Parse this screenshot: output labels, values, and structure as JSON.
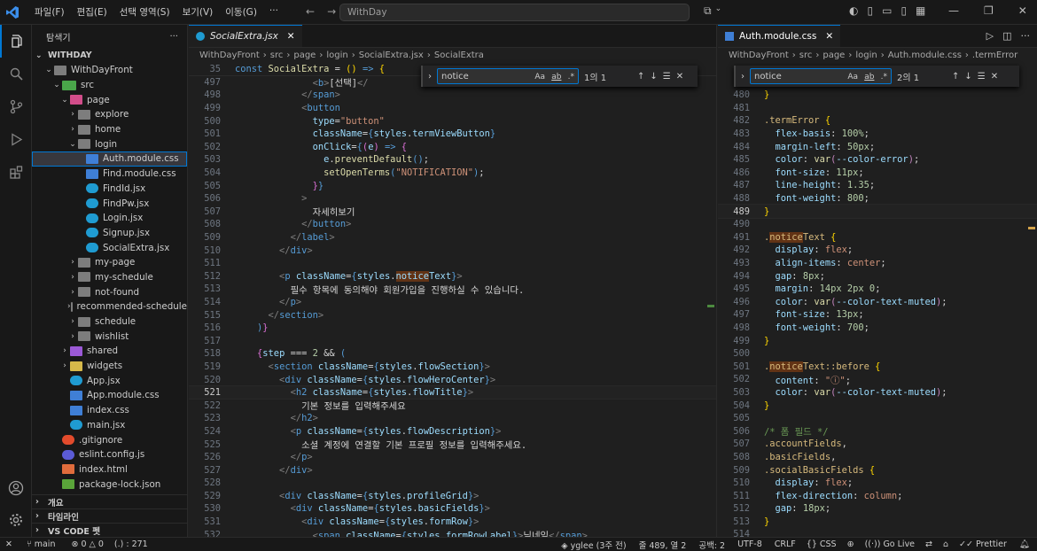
{
  "titlebar": {
    "menu": [
      "파일(F)",
      "편집(E)",
      "선택 영역(S)",
      "보기(V)",
      "이동(G)"
    ],
    "search_text": "WithDay",
    "more": "···"
  },
  "sidebar": {
    "title": "탐색기",
    "more": "···",
    "workspace": "WITHDAY",
    "tree": [
      {
        "label": "WithDayFront",
        "depth": 1,
        "chev": "⌄",
        "icon": "folder"
      },
      {
        "label": "src",
        "depth": 2,
        "chev": "⌄",
        "icon": "src"
      },
      {
        "label": "page",
        "depth": 3,
        "chev": "⌄",
        "icon": "page"
      },
      {
        "label": "explore",
        "depth": 4,
        "chev": "›",
        "icon": "folder"
      },
      {
        "label": "home",
        "depth": 4,
        "chev": "›",
        "icon": "folder"
      },
      {
        "label": "login",
        "depth": 4,
        "chev": "⌄",
        "icon": "folder"
      },
      {
        "label": "Auth.module.css",
        "depth": 5,
        "chev": "",
        "icon": "css",
        "selected": true
      },
      {
        "label": "Find.module.css",
        "depth": 5,
        "chev": "",
        "icon": "css"
      },
      {
        "label": "FindId.jsx",
        "depth": 5,
        "chev": "",
        "icon": "jsx"
      },
      {
        "label": "FindPw.jsx",
        "depth": 5,
        "chev": "",
        "icon": "jsx"
      },
      {
        "label": "Login.jsx",
        "depth": 5,
        "chev": "",
        "icon": "jsx"
      },
      {
        "label": "Signup.jsx",
        "depth": 5,
        "chev": "",
        "icon": "jsx"
      },
      {
        "label": "SocialExtra.jsx",
        "depth": 5,
        "chev": "",
        "icon": "jsx"
      },
      {
        "label": "my-page",
        "depth": 4,
        "chev": "›",
        "icon": "folder"
      },
      {
        "label": "my-schedule",
        "depth": 4,
        "chev": "›",
        "icon": "folder"
      },
      {
        "label": "not-found",
        "depth": 4,
        "chev": "›",
        "icon": "folder"
      },
      {
        "label": "recommended-schedule",
        "depth": 4,
        "chev": "›",
        "icon": "folder"
      },
      {
        "label": "schedule",
        "depth": 4,
        "chev": "›",
        "icon": "folder"
      },
      {
        "label": "wishlist",
        "depth": 4,
        "chev": "›",
        "icon": "folder"
      },
      {
        "label": "shared",
        "depth": 3,
        "chev": "›",
        "icon": "shared"
      },
      {
        "label": "widgets",
        "depth": 3,
        "chev": "›",
        "icon": "widgets"
      },
      {
        "label": "App.jsx",
        "depth": 3,
        "chev": "",
        "icon": "jsx"
      },
      {
        "label": "App.module.css",
        "depth": 3,
        "chev": "",
        "icon": "css"
      },
      {
        "label": "index.css",
        "depth": 3,
        "chev": "",
        "icon": "css"
      },
      {
        "label": "main.jsx",
        "depth": 3,
        "chev": "",
        "icon": "jsx"
      },
      {
        "label": ".gitignore",
        "depth": 2,
        "chev": "",
        "icon": "git"
      },
      {
        "label": "eslint.config.js",
        "depth": 2,
        "chev": "",
        "icon": "eslint"
      },
      {
        "label": "index.html",
        "depth": 2,
        "chev": "",
        "icon": "html"
      },
      {
        "label": "package-lock.json",
        "depth": 2,
        "chev": "",
        "icon": "json"
      }
    ],
    "sections": [
      "개요",
      "타임라인",
      "VS CODE 펫"
    ]
  },
  "left_editor": {
    "tab": "SocialExtra.jsx",
    "crumbs": [
      "WithDayFront",
      "src",
      "page",
      "login",
      "SocialExtra.jsx",
      "SocialExtra"
    ],
    "find": {
      "query": "notice",
      "count": "1의 1",
      "aa": "Aa",
      "ab": "ab",
      "re": ".*"
    },
    "sticky": {
      "num": "35",
      "code": "const SocialExtra = () => {"
    },
    "lines": [
      {
        "n": "497",
        "html": "              <span class='t'>&lt;</span><span class='tg'>b</span><span class='t'>&gt;</span><span class='tx'>[선택]</span><span class='t'>&lt;/</span>"
      },
      {
        "n": "498",
        "html": "            <span class='t'>&lt;/</span><span class='tg'>span</span><span class='t'>&gt;</span>"
      },
      {
        "n": "499",
        "html": "            <span class='t'>&lt;</span><span class='tg'>button</span>"
      },
      {
        "n": "500",
        "html": "              <span class='at'>type</span>=<span class='s'>\"button\"</span>"
      },
      {
        "n": "501",
        "html": "              <span class='at'>className</span>=<span class='k'>{</span><span class='v'>styles</span>.<span class='v'>termViewButton</span><span class='k'>}</span>"
      },
      {
        "n": "502",
        "html": "              <span class='at'>onClick</span>=<span class='k'>{</span><span class='p'>(</span><span class='v'>e</span><span class='p'>)</span> <span class='k'>=&gt;</span> <span class='p'>{</span>"
      },
      {
        "n": "503",
        "html": "                <span class='v'>e</span>.<span class='f'>preventDefault</span><span class='k'>()</span>;"
      },
      {
        "n": "504",
        "html": "                <span class='f'>setOpenTerms</span><span class='k'>(</span><span class='s'>\"NOTIFICATION\"</span><span class='k'>)</span>;"
      },
      {
        "n": "505",
        "html": "              <span class='p'>}</span><span class='k'>}</span>"
      },
      {
        "n": "506",
        "html": "            <span class='t'>&gt;</span>"
      },
      {
        "n": "507",
        "html": "              <span class='tx'>자세히보기</span>"
      },
      {
        "n": "508",
        "html": "            <span class='t'>&lt;/</span><span class='tg'>button</span><span class='t'>&gt;</span>"
      },
      {
        "n": "509",
        "html": "          <span class='t'>&lt;/</span><span class='tg'>label</span><span class='t'>&gt;</span>"
      },
      {
        "n": "510",
        "html": "        <span class='t'>&lt;/</span><span class='tg'>div</span><span class='t'>&gt;</span>"
      },
      {
        "n": "511",
        "html": ""
      },
      {
        "n": "512",
        "html": "        <span class='t'>&lt;</span><span class='tg'>p</span> <span class='at'>className</span>=<span class='k'>{</span><span class='v'>styles</span>.<span class='v'><span class='hl'>notice</span>Text</span><span class='k'>}</span><span class='t'>&gt;</span>"
      },
      {
        "n": "513",
        "html": "          <span class='tx'>필수 항목에 동의해야 회원가입을 진행하실 수 있습니다.</span>"
      },
      {
        "n": "514",
        "html": "        <span class='t'>&lt;/</span><span class='tg'>p</span><span class='t'>&gt;</span>"
      },
      {
        "n": "515",
        "html": "      <span class='t'>&lt;/</span><span class='tg'>section</span><span class='t'>&gt;</span>"
      },
      {
        "n": "516",
        "html": "    <span class='k'>)</span><span class='p'>}</span>"
      },
      {
        "n": "517",
        "html": ""
      },
      {
        "n": "518",
        "html": "    <span class='p'>{</span><span class='v'>step</span> === <span class='n'>2</span> &amp;&amp; <span class='k'>(</span>"
      },
      {
        "n": "519",
        "html": "      <span class='t'>&lt;</span><span class='tg'>section</span> <span class='at'>className</span>=<span class='k'>{</span><span class='v'>styles</span>.<span class='v'>flowSection</span><span class='k'>}</span><span class='t'>&gt;</span>"
      },
      {
        "n": "520",
        "html": "        <span class='t'>&lt;</span><span class='tg'>div</span> <span class='at'>className</span>=<span class='k'>{</span><span class='v'>styles</span>.<span class='v'>flowHeroCenter</span><span class='k'>}</span><span class='t'>&gt;</span>"
      },
      {
        "n": "521",
        "html": "          <span class='t'>&lt;</span><span class='tg'>h2</span> <span class='at'>className</span>=<span class='k'>{</span><span class='v'>styles</span>.<span class='v'>flowTitle</span><span class='k'>}</span><span class='t'>&gt;</span>",
        "cur": true
      },
      {
        "n": "522",
        "html": "            <span class='tx'>기본 정보를 입력해주세요</span>"
      },
      {
        "n": "523",
        "html": "          <span class='t'>&lt;/</span><span class='tg'>h2</span><span class='t'>&gt;</span>"
      },
      {
        "n": "524",
        "html": "          <span class='t'>&lt;</span><span class='tg'>p</span> <span class='at'>className</span>=<span class='k'>{</span><span class='v'>styles</span>.<span class='v'>flowDescription</span><span class='k'>}</span><span class='t'>&gt;</span>"
      },
      {
        "n": "525",
        "html": "            <span class='tx'>소셜 계정에 연결할 기본 프로필 정보를 입력해주세요.</span>"
      },
      {
        "n": "526",
        "html": "          <span class='t'>&lt;/</span><span class='tg'>p</span><span class='t'>&gt;</span>"
      },
      {
        "n": "527",
        "html": "        <span class='t'>&lt;/</span><span class='tg'>div</span><span class='t'>&gt;</span>"
      },
      {
        "n": "528",
        "html": ""
      },
      {
        "n": "529",
        "html": "        <span class='t'>&lt;</span><span class='tg'>div</span> <span class='at'>className</span>=<span class='k'>{</span><span class='v'>styles</span>.<span class='v'>profileGrid</span><span class='k'>}</span><span class='t'>&gt;</span>"
      },
      {
        "n": "530",
        "html": "          <span class='t'>&lt;</span><span class='tg'>div</span> <span class='at'>className</span>=<span class='k'>{</span><span class='v'>styles</span>.<span class='v'>basicFields</span><span class='k'>}</span><span class='t'>&gt;</span>"
      },
      {
        "n": "531",
        "html": "            <span class='t'>&lt;</span><span class='tg'>div</span> <span class='at'>className</span>=<span class='k'>{</span><span class='v'>styles</span>.<span class='v'>formRow</span><span class='k'>}</span><span class='t'>&gt;</span>"
      },
      {
        "n": "532",
        "html": "              <span class='t'>&lt;</span><span class='tg'>span</span> <span class='at'>className</span>=<span class='k'>{</span><span class='v'>styles</span>.<span class='v'>formRowLabel</span><span class='k'>}</span><span class='t'>&gt;</span><span class='tx'>닉네임</span><span class='t'>&lt;/</span><span class='tg'>span</span><span class='t'>&gt;</span>"
      }
    ]
  },
  "right_editor": {
    "tab": "Auth.module.css",
    "crumbs": [
      "WithDayFront",
      "src",
      "page",
      "login",
      "Auth.module.css",
      ".termError"
    ],
    "find": {
      "query": "notice",
      "count": "2의 1",
      "aa": "Aa",
      "ab": "ab",
      "re": ".*"
    },
    "lines": [
      {
        "n": "480",
        "html": "<span class='y'>}</span>"
      },
      {
        "n": "481",
        "html": ""
      },
      {
        "n": "482",
        "html": "<span class='pr'>.termError</span> <span class='y'>{</span>"
      },
      {
        "n": "483",
        "html": "  <span class='v'>flex-basis</span>: <span class='n'>100%</span>;"
      },
      {
        "n": "484",
        "html": "  <span class='v'>margin-left</span>: <span class='n'>50px</span>;"
      },
      {
        "n": "485",
        "html": "  <span class='v'>color</span>: <span class='f'>var</span><span class='kw'>(</span><span class='v'>--color-error</span><span class='kw'>)</span>;"
      },
      {
        "n": "486",
        "html": "  <span class='v'>font-size</span>: <span class='n'>11px</span>;"
      },
      {
        "n": "487",
        "html": "  <span class='v'>line-height</span>: <span class='n'>1.35</span>;"
      },
      {
        "n": "488",
        "html": "  <span class='v'>font-weight</span>: <span class='n'>800</span>;"
      },
      {
        "n": "489",
        "html": "<span class='y'>}</span>",
        "cur": true
      },
      {
        "n": "490",
        "html": ""
      },
      {
        "n": "491",
        "html": "<span class='pr'>.<span class='hl'>notice</span>Text</span> <span class='y'>{</span>"
      },
      {
        "n": "492",
        "html": "  <span class='v'>display</span>: <span class='s'>flex</span>;"
      },
      {
        "n": "493",
        "html": "  <span class='v'>align-items</span>: <span class='s'>center</span>;"
      },
      {
        "n": "494",
        "html": "  <span class='v'>gap</span>: <span class='n'>8px</span>;"
      },
      {
        "n": "495",
        "html": "  <span class='v'>margin</span>: <span class='n'>14px</span> <span class='n'>2px</span> <span class='n'>0</span>;"
      },
      {
        "n": "496",
        "html": "  <span class='v'>color</span>: <span class='f'>var</span><span class='kw'>(</span><span class='v'>--color-text-muted</span><span class='kw'>)</span>;"
      },
      {
        "n": "497",
        "html": "  <span class='v'>font-size</span>: <span class='n'>13px</span>;"
      },
      {
        "n": "498",
        "html": "  <span class='v'>font-weight</span>: <span class='n'>700</span>;"
      },
      {
        "n": "499",
        "html": "<span class='y'>}</span>"
      },
      {
        "n": "500",
        "html": ""
      },
      {
        "n": "501",
        "html": "<span class='pr'>.<span class='hl'>notice</span>Text::before</span> <span class='y'>{</span>"
      },
      {
        "n": "502",
        "html": "  <span class='v'>content</span>: <span class='s'>\"ⓘ\"</span>;"
      },
      {
        "n": "503",
        "html": "  <span class='v'>color</span>: <span class='f'>var</span><span class='kw'>(</span><span class='v'>--color-text-muted</span><span class='kw'>)</span>;"
      },
      {
        "n": "504",
        "html": "<span class='y'>}</span>"
      },
      {
        "n": "505",
        "html": ""
      },
      {
        "n": "506",
        "html": "<span class='c'>/* 폼 필드 */</span>"
      },
      {
        "n": "507",
        "html": "<span class='pr'>.accountFields</span>,"
      },
      {
        "n": "508",
        "html": "<span class='pr'>.basicFields</span>,"
      },
      {
        "n": "509",
        "html": "<span class='pr'>.socialBasicFields</span> <span class='y'>{</span>"
      },
      {
        "n": "510",
        "html": "  <span class='v'>display</span>: <span class='s'>flex</span>;"
      },
      {
        "n": "511",
        "html": "  <span class='v'>flex-direction</span>: <span class='s'>column</span>;"
      },
      {
        "n": "512",
        "html": "  <span class='v'>gap</span>: <span class='n'>18px</span>;"
      },
      {
        "n": "513",
        "html": "<span class='y'>}</span>"
      },
      {
        "n": "514",
        "html": ""
      }
    ]
  },
  "status": {
    "branch": "main",
    "errors": "0",
    "warnings": "0",
    "selection": "(.) : 271",
    "blame": "yglee (3주 전)",
    "position": "줄 489, 열 2",
    "spaces": "공백: 2",
    "encoding": "UTF-8",
    "eol": "CRLF",
    "language": "CSS",
    "golive": "Go Live",
    "prettier": "Prettier"
  }
}
